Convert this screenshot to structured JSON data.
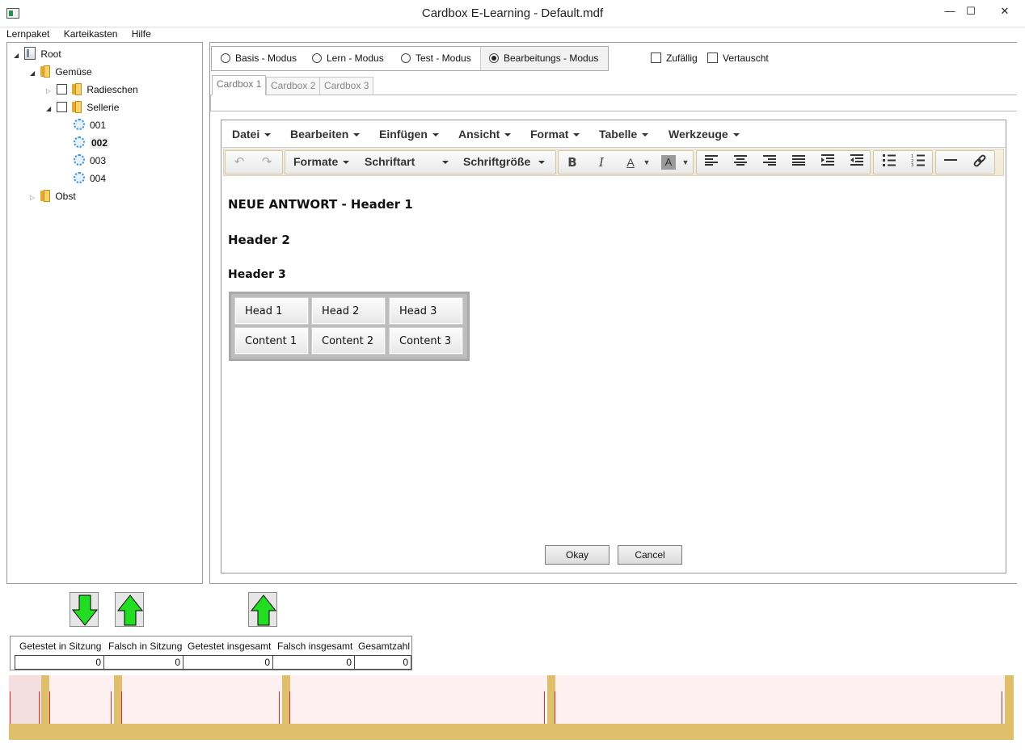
{
  "window": {
    "title": "Cardbox E-Learning - Default.mdf",
    "controls": [
      "—",
      "☐",
      "✕"
    ]
  },
  "menubar": [
    "Lernpaket",
    "Karteikasten",
    "Hilfe"
  ],
  "tree": {
    "root": "Root",
    "nodes": [
      {
        "label": "Gemüse"
      },
      {
        "label": "Radieschen"
      },
      {
        "label": "Sellerie"
      },
      {
        "label": "001"
      },
      {
        "label": "002"
      },
      {
        "label": "003"
      },
      {
        "label": "004"
      },
      {
        "label": "Obst"
      }
    ]
  },
  "modes": {
    "options": [
      "Basis - Modus",
      "Lern - Modus",
      "Test - Modus",
      "Bearbeitungs - Modus"
    ],
    "selected": "Bearbeitungs - Modus"
  },
  "options": {
    "zufaellig": "Zufällig",
    "vertauscht": "Vertauscht"
  },
  "tabs": [
    "Cardbox 1",
    "Cardbox 2",
    "Cardbox 3"
  ],
  "editor": {
    "menus": [
      "Datei",
      "Bearbeiten",
      "Einfügen",
      "Ansicht",
      "Format",
      "Tabelle",
      "Werkzeuge"
    ],
    "toolbar": {
      "formats": "Formate",
      "font": "Schriftart",
      "fontsize": "Schriftgröße",
      "bold": "B",
      "italic": "I",
      "fontcolor": "A",
      "bgcolor": "A"
    },
    "content": {
      "h1": "NEUE ANTWORT - Header 1",
      "h2": "Header 2",
      "h3": "Header 3",
      "table": {
        "header": [
          "Head 1",
          "Head 2",
          "Head 3"
        ],
        "row": [
          "Content 1",
          "Content 2",
          "Content 3"
        ]
      }
    },
    "ok_label": "Okay",
    "cancel_label": "Cancel"
  },
  "stats": {
    "headers": [
      "Getestet in Sitzung",
      "Falsch in Sitzung",
      "Getestet insgesamt",
      "Falsch insgesamt",
      "Gesamtzahl"
    ],
    "values": [
      "0",
      "0",
      "0",
      "0",
      "0"
    ]
  },
  "colors": {
    "arrow_green": "#22dd22",
    "strip_gold": "#dfbf6b",
    "strip_red": "#d03030"
  }
}
